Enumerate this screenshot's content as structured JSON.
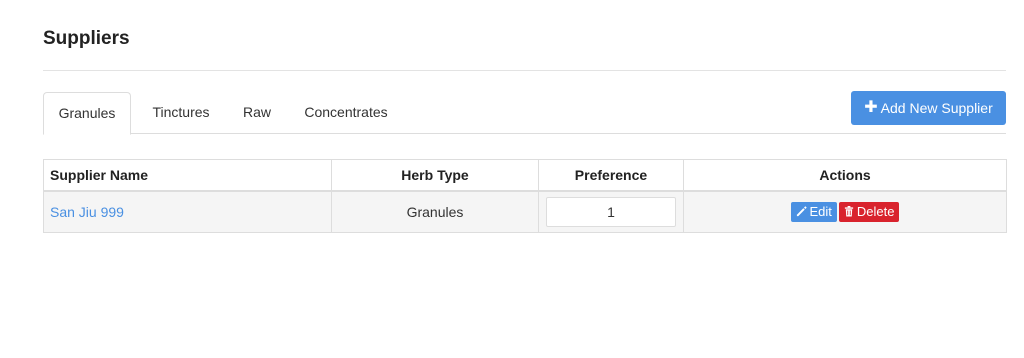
{
  "page": {
    "title": "Suppliers"
  },
  "tabs": [
    {
      "label": "Granules",
      "active": true
    },
    {
      "label": "Tinctures",
      "active": false
    },
    {
      "label": "Raw",
      "active": false
    },
    {
      "label": "Concentrates",
      "active": false
    }
  ],
  "add_button": {
    "label": "Add New Supplier",
    "icon": "plus-icon"
  },
  "table": {
    "headers": {
      "name": "Supplier Name",
      "herb_type": "Herb Type",
      "preference": "Preference",
      "actions": "Actions"
    },
    "rows": [
      {
        "name": "San Jiu 999",
        "herb_type": "Granules",
        "preference": "1",
        "edit_label": "Edit",
        "delete_label": "Delete"
      }
    ]
  },
  "colors": {
    "accent": "#4a90e2",
    "danger": "#d9232d",
    "row_bg": "#f5f5f5",
    "border": "#dddddd"
  },
  "icons": {
    "edit": "pencil-icon",
    "delete": "trash-icon",
    "add": "plus-icon"
  }
}
